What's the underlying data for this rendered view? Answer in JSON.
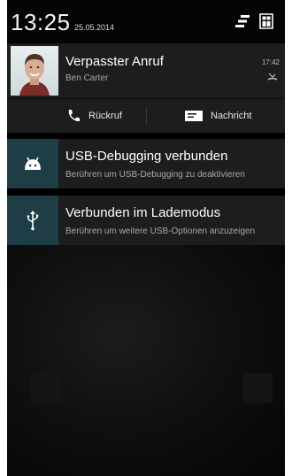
{
  "status_bar": {
    "time": "13:25",
    "date": "25.05.2014",
    "icons": [
      "usb-debug-icon",
      "sim-icon"
    ]
  },
  "notifications": {
    "missed_call": {
      "title": "Verpasster Anruf",
      "caller": "Ben Carter",
      "time": "17:42",
      "icon": "missed-call-icon",
      "actions": [
        {
          "label": "Rückruf",
          "icon": "phone-icon"
        },
        {
          "label": "Nachricht",
          "icon": "message-icon"
        }
      ]
    },
    "usb_debugging": {
      "title": "USB-Debugging verbunden",
      "subtitle": "Berühren um USB-Debugging zu deaktivieren",
      "icon": "android-debug-icon"
    },
    "usb_charging": {
      "title": "Verbunden im Lademodus",
      "subtitle": "Berühren um weitere USB-Optionen anzuzeigen",
      "icon": "usb-icon"
    }
  },
  "colors": {
    "panel_bg": "#1d1d1d",
    "icon_box_bg": "#1f3d44",
    "background": "#000000"
  }
}
